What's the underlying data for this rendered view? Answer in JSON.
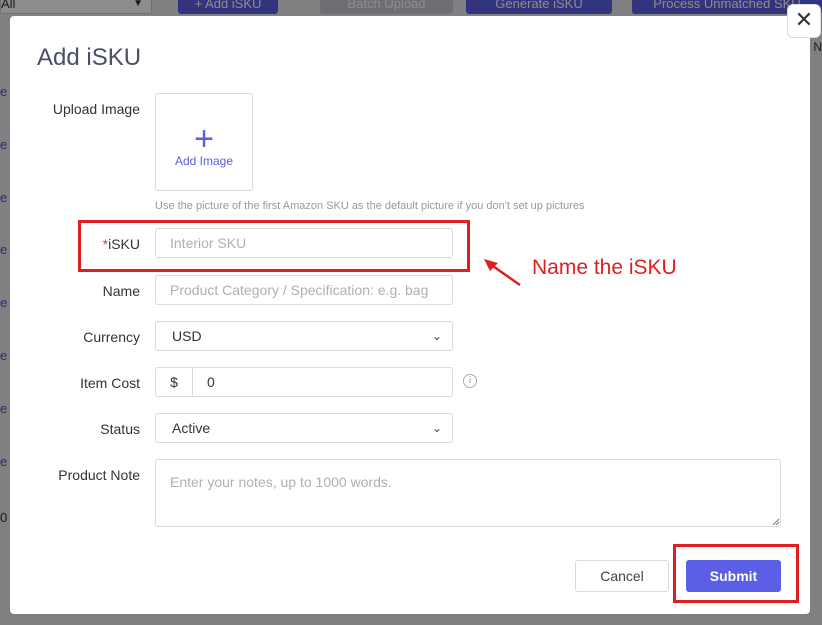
{
  "background": {
    "filter_value": "All",
    "buttons": [
      {
        "label": "+ Add iSKU",
        "color": "#5b5fe6"
      },
      {
        "label": "Batch Upload",
        "color": "#c9c9d4"
      },
      {
        "label": "Generate iSKU",
        "color": "#5b5fe6"
      },
      {
        "label": "Process Unmatched SKU",
        "color": "#5b5fe6"
      }
    ],
    "side_links": [
      "e",
      "e",
      "e",
      "e",
      "e",
      "e",
      "e",
      "e"
    ],
    "side_number": "0",
    "right_edge_text": "N"
  },
  "modal": {
    "title": "Add iSKU",
    "close_glyph": "✕",
    "upload": {
      "label": "Upload Image",
      "plus_glyph": "+",
      "button_text": "Add Image",
      "hint": "Use the picture of the first Amazon SKU as the default picture if you don't set up pictures"
    },
    "isku": {
      "required_mark": "*",
      "label": "iSKU",
      "placeholder": "Interior SKU",
      "value": ""
    },
    "name": {
      "label": "Name",
      "placeholder": "Product Category / Specification: e.g. bag",
      "value": ""
    },
    "currency": {
      "label": "Currency",
      "value": "USD",
      "chevron": "⌄"
    },
    "item_cost": {
      "label": "Item Cost",
      "prefix": "$",
      "value": "0",
      "info_glyph": "i"
    },
    "status": {
      "label": "Status",
      "value": "Active",
      "chevron": "⌄"
    },
    "product_note": {
      "label": "Product Note",
      "placeholder": "Enter your notes, up to 1000 words.",
      "value": ""
    },
    "cancel_label": "Cancel",
    "submit_label": "Submit"
  },
  "annotation": {
    "text": "Name the iSKU",
    "color": "#e02020"
  }
}
